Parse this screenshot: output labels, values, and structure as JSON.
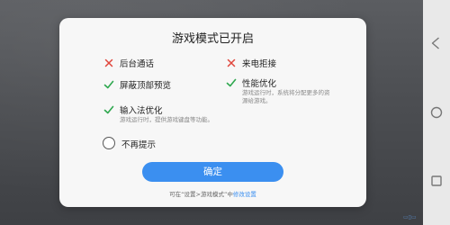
{
  "dialog": {
    "title": "游戏模式已开启",
    "options": [
      {
        "label": "后台通话",
        "enabled": false,
        "mark_icon": "cross-icon"
      },
      {
        "label": "来电拒接",
        "enabled": false,
        "mark_icon": "cross-icon"
      },
      {
        "label": "屏蔽顶部预览",
        "enabled": true,
        "mark_icon": "check-icon"
      },
      {
        "label": "性能优化",
        "enabled": true,
        "mark_icon": "check-icon",
        "description": "游戏运行时，系统将分配更多的资源给游戏。"
      },
      {
        "label": "输入法优化",
        "enabled": true,
        "mark_icon": "check-icon",
        "description": "游戏运行时，提供游戏键盘等功能。"
      }
    ],
    "dont_show_again": {
      "label": "不再提示",
      "checked": false
    },
    "confirm_label": "确定",
    "footer": {
      "prefix": "可在“设置>游戏模式”中",
      "link": "修改设置"
    }
  },
  "navbar": {
    "icons": [
      "back-icon",
      "home-icon",
      "recent-apps-icon"
    ]
  },
  "colors": {
    "accent": "#3b8ff0",
    "cross": "#e0463c",
    "check": "#2fa84f",
    "dialog_bg": "#f7f7f7"
  }
}
